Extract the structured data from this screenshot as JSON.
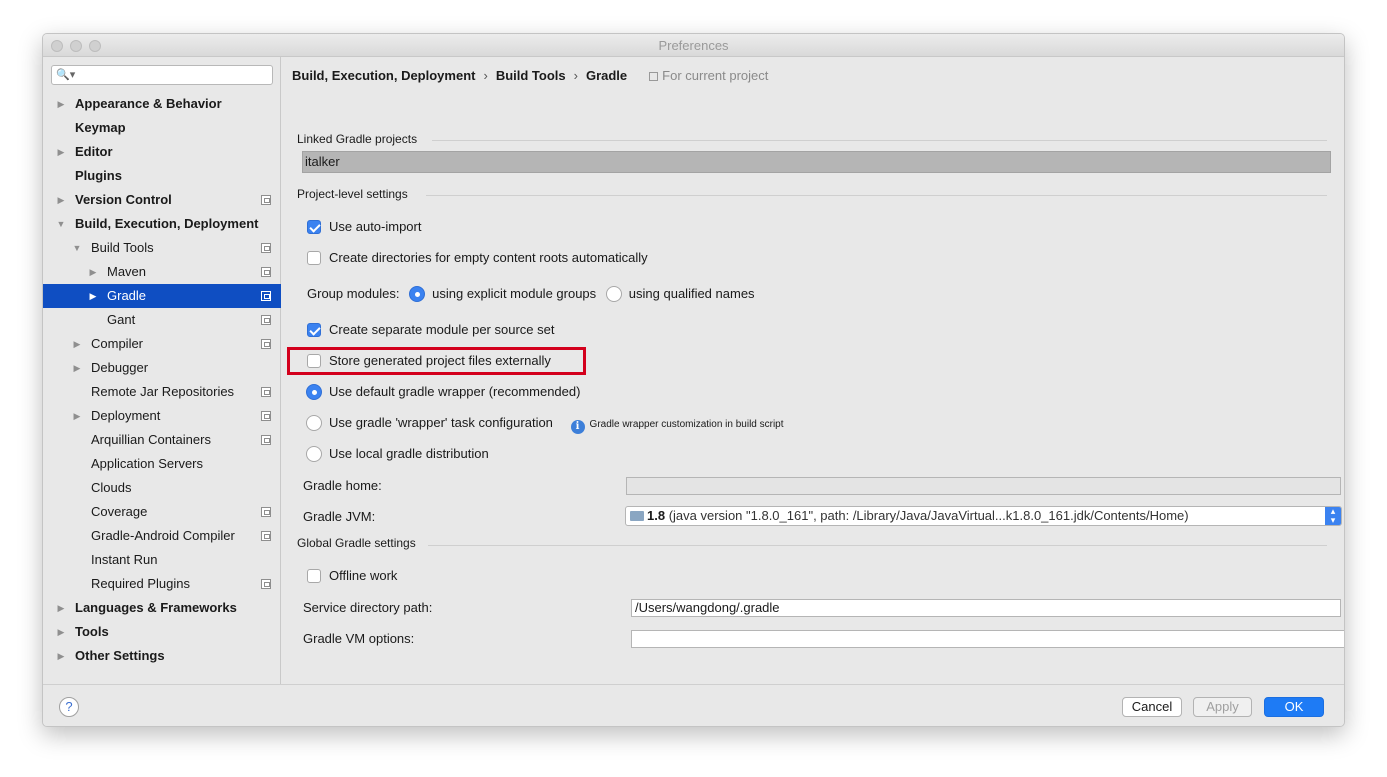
{
  "window": {
    "title": "Preferences"
  },
  "sidebar": {
    "search_placeholder": "",
    "items": [
      {
        "label": "Appearance & Behavior",
        "bold": true,
        "arrow": "right",
        "level": 0,
        "project": false
      },
      {
        "label": "Keymap",
        "bold": true,
        "arrow": "",
        "level": 0,
        "project": false
      },
      {
        "label": "Editor",
        "bold": true,
        "arrow": "right",
        "level": 0,
        "project": false
      },
      {
        "label": "Plugins",
        "bold": true,
        "arrow": "",
        "level": 0,
        "project": false
      },
      {
        "label": "Version Control",
        "bold": true,
        "arrow": "right",
        "level": 0,
        "project": true
      },
      {
        "label": "Build, Execution, Deployment",
        "bold": true,
        "arrow": "down",
        "level": 0,
        "project": false
      },
      {
        "label": "Build Tools",
        "bold": false,
        "arrow": "down",
        "level": 1,
        "project": true
      },
      {
        "label": "Maven",
        "bold": false,
        "arrow": "right",
        "level": 2,
        "project": true
      },
      {
        "label": "Gradle",
        "bold": false,
        "arrow": "right",
        "level": 2,
        "project": true,
        "selected": true
      },
      {
        "label": "Gant",
        "bold": false,
        "arrow": "",
        "level": 2,
        "project": true
      },
      {
        "label": "Compiler",
        "bold": false,
        "arrow": "right",
        "level": 1,
        "project": true
      },
      {
        "label": "Debugger",
        "bold": false,
        "arrow": "right",
        "level": 1,
        "project": false
      },
      {
        "label": "Remote Jar Repositories",
        "bold": false,
        "arrow": "",
        "level": 1,
        "project": true
      },
      {
        "label": "Deployment",
        "bold": false,
        "arrow": "right",
        "level": 1,
        "project": true
      },
      {
        "label": "Arquillian Containers",
        "bold": false,
        "arrow": "",
        "level": 1,
        "project": true
      },
      {
        "label": "Application Servers",
        "bold": false,
        "arrow": "",
        "level": 1,
        "project": false
      },
      {
        "label": "Clouds",
        "bold": false,
        "arrow": "",
        "level": 1,
        "project": false
      },
      {
        "label": "Coverage",
        "bold": false,
        "arrow": "",
        "level": 1,
        "project": true
      },
      {
        "label": "Gradle-Android Compiler",
        "bold": false,
        "arrow": "",
        "level": 1,
        "project": true
      },
      {
        "label": "Instant Run",
        "bold": false,
        "arrow": "",
        "level": 1,
        "project": false
      },
      {
        "label": "Required Plugins",
        "bold": false,
        "arrow": "",
        "level": 1,
        "project": true
      },
      {
        "label": "Languages & Frameworks",
        "bold": true,
        "arrow": "right",
        "level": 0,
        "project": false
      },
      {
        "label": "Tools",
        "bold": true,
        "arrow": "right",
        "level": 0,
        "project": false
      },
      {
        "label": "Other Settings",
        "bold": true,
        "arrow": "right",
        "level": 0,
        "project": false
      }
    ]
  },
  "breadcrumb": {
    "items": [
      "Build, Execution, Deployment",
      "Build Tools",
      "Gradle"
    ],
    "separator": "›",
    "scope": "For current project"
  },
  "linked": {
    "section": "Linked Gradle projects",
    "project": "italker"
  },
  "project_settings": {
    "section": "Project-level settings",
    "auto_import": {
      "label": "Use auto-import",
      "checked": true
    },
    "create_dirs": {
      "label": "Create directories for empty content roots automatically",
      "checked": false
    },
    "group_modules": {
      "label": "Group modules:",
      "option1": "using explicit module groups",
      "option2": "using qualified names",
      "selected": "option1"
    },
    "separate_module": {
      "label": "Create separate module per source set",
      "checked": true
    },
    "store_external": {
      "label": "Store generated project files externally",
      "checked": false
    },
    "wrapper_default": {
      "label": "Use default gradle wrapper (recommended)",
      "checked": true
    },
    "wrapper_task": {
      "label": "Use gradle 'wrapper' task configuration",
      "checked": false
    },
    "wrapper_hint": "Gradle wrapper customization in build script",
    "local_dist": {
      "label": "Use local gradle distribution",
      "checked": false
    },
    "gradle_home": {
      "label": "Gradle home:",
      "value": ""
    },
    "gradle_jvm": {
      "label": "Gradle JVM:",
      "version": "1.8",
      "detail": "(java version \"1.8.0_161\", path: /Library/Java/JavaVirtual...k1.8.0_161.jdk/Contents/Home)"
    },
    "browse": "..."
  },
  "global_settings": {
    "section": "Global Gradle settings",
    "offline": {
      "label": "Offline work",
      "checked": false
    },
    "service_dir": {
      "label": "Service directory path:",
      "value": "/Users/wangdong/.gradle"
    },
    "vm_options": {
      "label": "Gradle VM options:",
      "value": ""
    }
  },
  "footer": {
    "help": "?",
    "cancel": "Cancel",
    "apply": "Apply",
    "ok": "OK"
  },
  "colors": {
    "selection": "#0f4ec2",
    "accent": "#3b82f0",
    "highlight_border": "#d3001c",
    "ok_button": "#1e7bf5"
  }
}
